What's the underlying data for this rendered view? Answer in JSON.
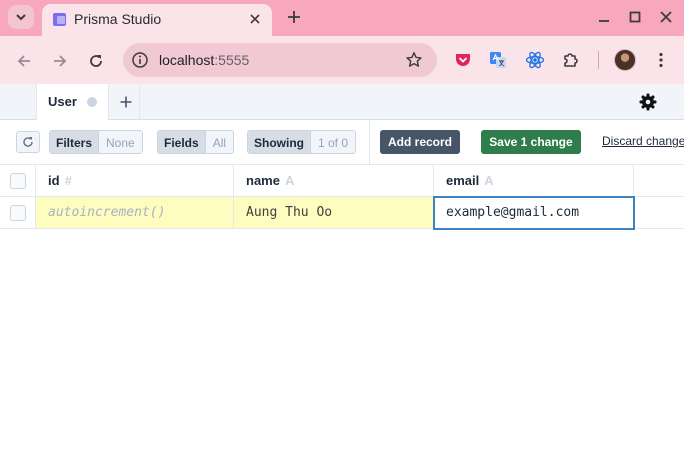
{
  "browser": {
    "tab_title": "Prisma Studio",
    "url_host": "localhost",
    "url_port": ":5555",
    "icons": {
      "tab_search": "chevron-down-icon",
      "favicon": "prisma-icon",
      "close": "close-icon",
      "new_tab": "plus-icon",
      "minimize": "minimize-icon",
      "maximize": "maximize-icon",
      "window_close": "window-close-icon",
      "back": "arrow-left-icon",
      "forward": "arrow-right-icon",
      "reload": "reload-icon",
      "site_info": "site-info-icon",
      "bookmark": "star-icon",
      "pocket": "pocket-icon",
      "translate": "translate-icon",
      "react_devtools": "react-icon",
      "extensions": "puzzle-icon",
      "profile": "avatar",
      "menu": "kebab-menu-icon"
    },
    "colors": {
      "frame": "#f7a8bd",
      "toolbar": "#fbe3ea",
      "pocket": "#e0245e",
      "react": "#1a73e8"
    }
  },
  "app": {
    "model_tab": "User",
    "settings_icon": "gear-icon",
    "toolbar": {
      "filters_label": "Filters",
      "filters_value": "None",
      "fields_label": "Fields",
      "fields_value": "All",
      "showing_label": "Showing",
      "showing_value": "1 of 0",
      "add_record": "Add record",
      "save_changes": "Save 1 change",
      "discard_changes": "Discard changes"
    },
    "columns": [
      {
        "name": "id",
        "type": "#"
      },
      {
        "name": "name",
        "type": "A"
      },
      {
        "name": "email",
        "type": "A"
      }
    ],
    "rows": [
      {
        "id": "autoincrement()",
        "name": "Aung Thu Oo",
        "email": "example@gmail.com"
      }
    ],
    "colors": {
      "save": "#2f7d4a",
      "add_record": "#475569",
      "changed_cell": "#fefcbf",
      "selected_border": "#3b82c4"
    }
  }
}
